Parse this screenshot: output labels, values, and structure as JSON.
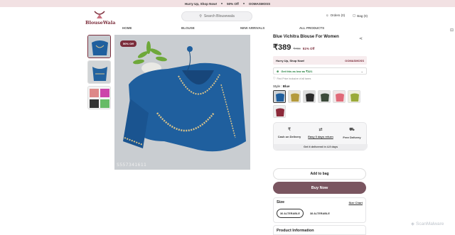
{
  "promo": {
    "left": "Hurry Up, Shop Now!",
    "middle": "50% Off",
    "right": "OOMASMOSS"
  },
  "header": {
    "logo_text": "BlouseWala",
    "search_placeholder": "Search Blousewala",
    "orders_label": "Orders (0)",
    "bag_label": "Bag (0)"
  },
  "nav": [
    "HOME",
    "BLOUSE",
    "NEW ARRIVALS",
    "ALL PRODUCTS"
  ],
  "gallery": {
    "badge": "50% Off",
    "image_code": "S557341611"
  },
  "product": {
    "title": "Blue Vichitra Blouse For Women",
    "price": "₹389",
    "mrp": "₹799",
    "discount": "51% Off",
    "deal_text": "Hurry Up, Shop Now!",
    "deal_code": "OOMASMOSS",
    "low_price": "Get this as low as ₹321",
    "find_text": "Find Price inclusive of all taxes",
    "style_label": "Style :",
    "style_value": "Blue"
  },
  "features": {
    "cod": "Cash on Delivery",
    "returns": "Easy 0 days return",
    "free": "Free Delivery",
    "delivery_note": "Get it delivered in 4-9 days"
  },
  "buttons": {
    "add_to_bag": "Add to bag",
    "buy_now": "Buy Now"
  },
  "size": {
    "label": "Size",
    "chart": "Size Chart",
    "options": [
      "36 ALTERABLE",
      "38 ALTERABLE"
    ]
  },
  "product_info_label": "Product Information",
  "corner_mark": "ScanMalware",
  "colors": {
    "brand": "#7b2d3b",
    "buy_button": "#7a5560",
    "promo_bg": "#f2e1e3",
    "blouse_blue": "#1f5f9e"
  }
}
